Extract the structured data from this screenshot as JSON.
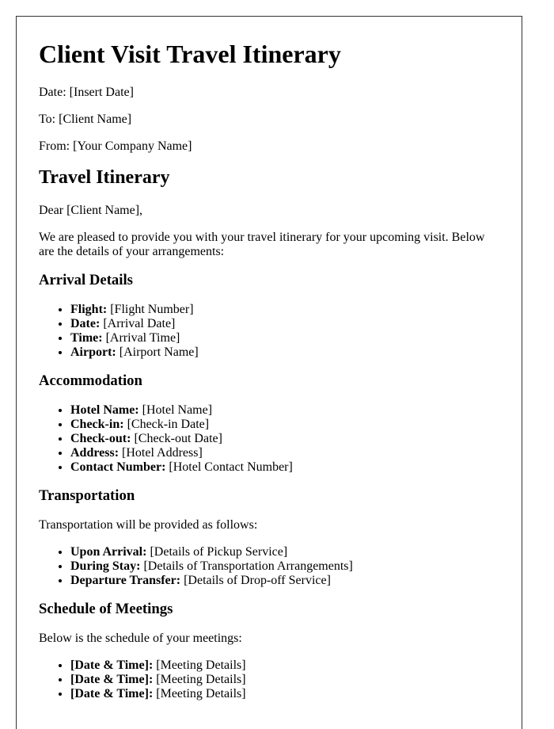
{
  "document": {
    "title": "Client Visit Travel Itinerary",
    "meta": [
      {
        "label": "Date:",
        "value": "[Insert Date]"
      },
      {
        "label": "To:",
        "value": "[Client Name]"
      },
      {
        "label": "From:",
        "value": "[Your Company Name]"
      }
    ],
    "section_title": "Travel Itinerary",
    "greeting": "Dear [Client Name],",
    "intro": "We are pleased to provide you with your travel itinerary for your upcoming visit. Below are the details of your arrangements:",
    "arrival": {
      "heading": "Arrival Details",
      "items": [
        {
          "label": "Flight:",
          "value": "[Flight Number]"
        },
        {
          "label": "Date:",
          "value": "[Arrival Date]"
        },
        {
          "label": "Time:",
          "value": "[Arrival Time]"
        },
        {
          "label": "Airport:",
          "value": "[Airport Name]"
        }
      ]
    },
    "accommodation": {
      "heading": "Accommodation",
      "items": [
        {
          "label": "Hotel Name:",
          "value": "[Hotel Name]"
        },
        {
          "label": "Check-in:",
          "value": "[Check-in Date]"
        },
        {
          "label": "Check-out:",
          "value": "[Check-out Date]"
        },
        {
          "label": "Address:",
          "value": "[Hotel Address]"
        },
        {
          "label": "Contact Number:",
          "value": "[Hotel Contact Number]"
        }
      ]
    },
    "transportation": {
      "heading": "Transportation",
      "intro": "Transportation will be provided as follows:",
      "items": [
        {
          "label": "Upon Arrival:",
          "value": "[Details of Pickup Service]"
        },
        {
          "label": "During Stay:",
          "value": "[Details of Transportation Arrangements]"
        },
        {
          "label": "Departure Transfer:",
          "value": "[Details of Drop-off Service]"
        }
      ]
    },
    "meetings": {
      "heading": "Schedule of Meetings",
      "intro": "Below is the schedule of your meetings:",
      "items": [
        {
          "label": "[Date & Time]:",
          "value": "[Meeting Details]"
        },
        {
          "label": "[Date & Time]:",
          "value": "[Meeting Details]"
        },
        {
          "label": "[Date & Time]:",
          "value": "[Meeting Details]"
        }
      ]
    }
  }
}
